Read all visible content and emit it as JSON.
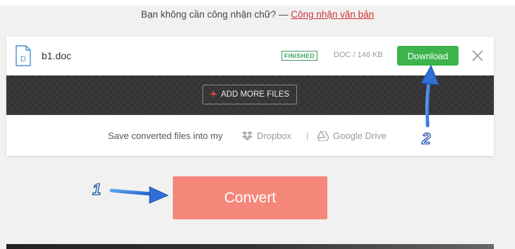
{
  "ocr_prompt": {
    "text": "Bạn không cần công nhận chữ? — ",
    "link": "Công nhận văn bản"
  },
  "file": {
    "icon_letter": "D",
    "name": "b1.doc",
    "status": "FINISHED",
    "meta": "DOC / 146 KB",
    "download_label": "Download"
  },
  "add_files": {
    "label": "ADD MORE FILES"
  },
  "save": {
    "label": "Save converted files into my",
    "dropbox": "Dropbox",
    "separator": "|",
    "gdrive": "Google Drive"
  },
  "convert": {
    "label": "Convert"
  },
  "annotations": {
    "step1": "1",
    "step2": "2"
  },
  "colors": {
    "download": "#3cb44b",
    "convert": "#f5877a",
    "status": "#3a9d5d",
    "annotation_arrow": "#2f6fd6"
  },
  "icons": [
    "file-doc-icon",
    "close-icon",
    "plus-icon",
    "dropbox-icon",
    "google-drive-icon",
    "arrow-icon"
  ]
}
